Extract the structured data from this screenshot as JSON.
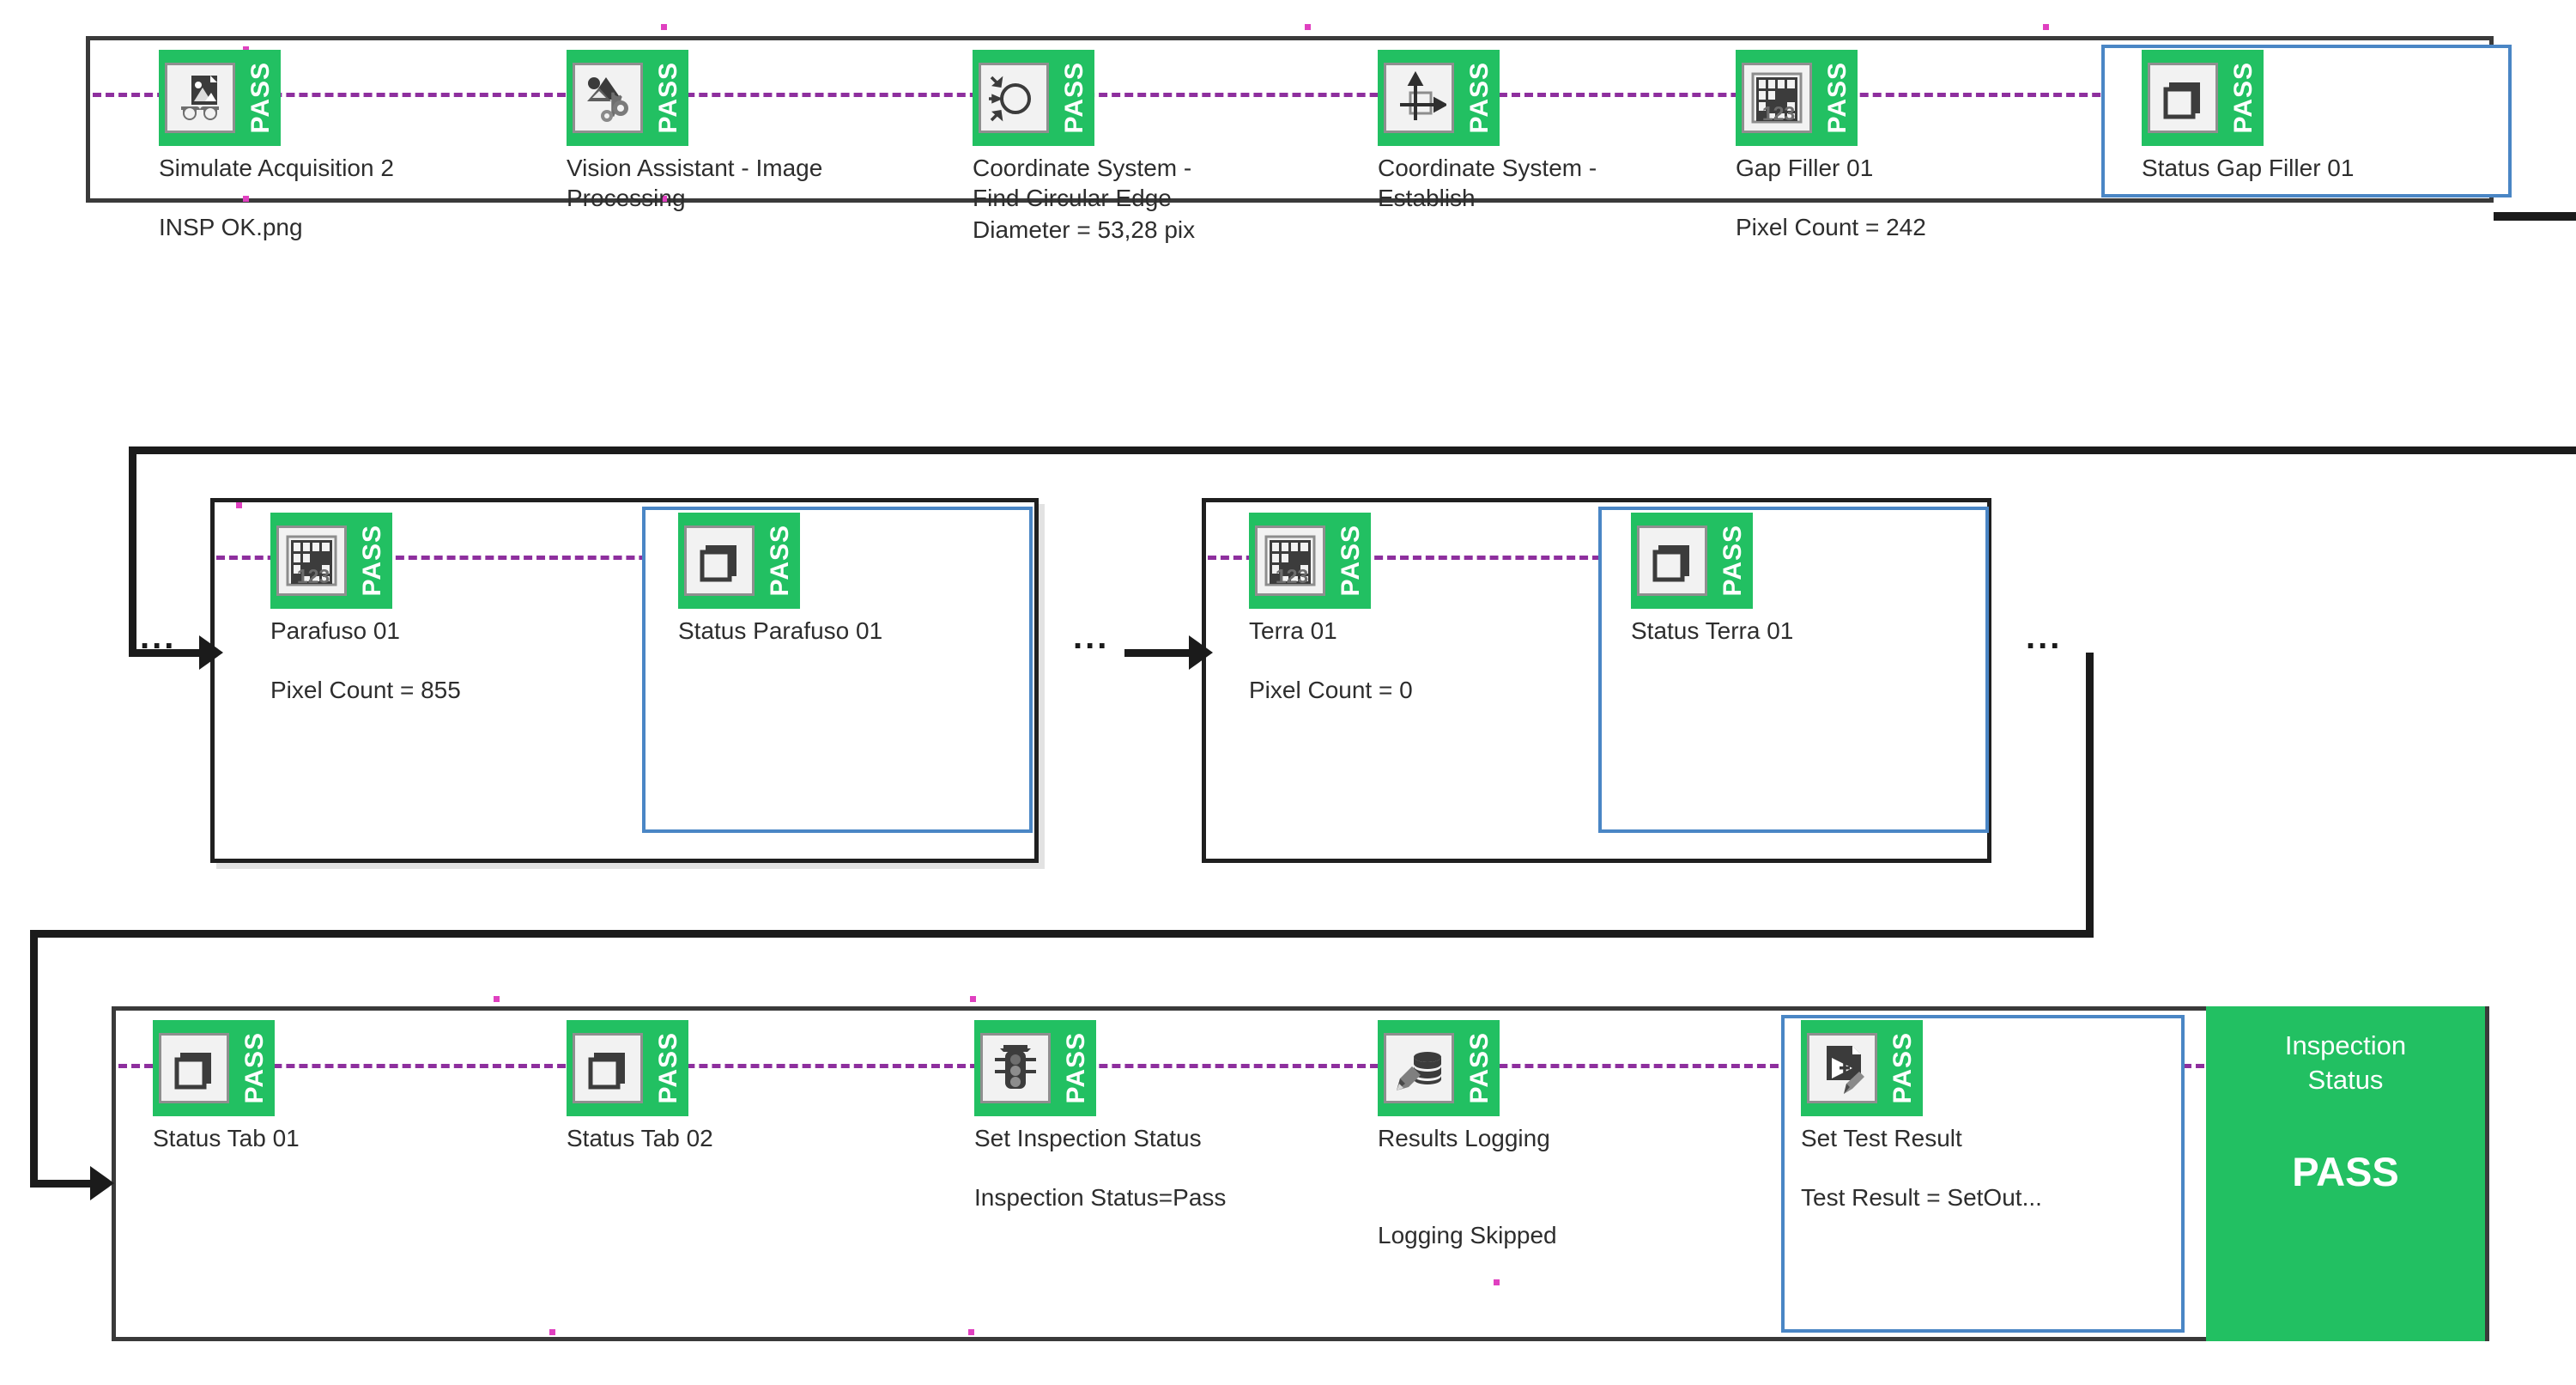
{
  "meta": {
    "app": "Vision Builder AI Inspection Flow",
    "pass_label": "PASS",
    "ellipsis": "...",
    "colors": {
      "pass_green": "#22c062",
      "selection_blue": "#4a86c5",
      "wire_magenta": "#8e2f9e",
      "frame_dark": "#3a3a3a"
    }
  },
  "rows": [
    {
      "id": "row-1",
      "steps": [
        {
          "name": "simulate-acquisition-2",
          "icon": "image-inspect-glasses-icon",
          "label": "Simulate Acquisition 2",
          "detail": "INSP OK.png",
          "status": "PASS",
          "selected": false
        },
        {
          "name": "vision-assistant-image-processing",
          "icon": "image-processing-gears-icon",
          "label": "Vision Assistant - Image\nProcessing",
          "detail": "",
          "status": "PASS",
          "selected": false
        },
        {
          "name": "coordinate-system-find-circular-edge",
          "icon": "find-circular-edge-icon",
          "label": "Coordinate System -\nFind Circular Edge",
          "detail": "Diameter = 53,28 pix",
          "status": "PASS",
          "selected": false
        },
        {
          "name": "coordinate-system-establish",
          "icon": "coordinate-axes-icon",
          "label": "Coordinate System -\nEstablish",
          "detail": "",
          "status": "PASS",
          "selected": false
        },
        {
          "name": "gap-filler-01",
          "icon": "pixel-count-123-icon",
          "label": "Gap Filler 01",
          "detail": "Pixel Count = 242",
          "status": "PASS",
          "selected": false
        },
        {
          "name": "status-gap-filler-01",
          "icon": "status-squares-icon",
          "label": "Status Gap Filler 01",
          "detail": "",
          "status": "PASS",
          "selected": true
        }
      ]
    },
    {
      "id": "row-2",
      "groups": [
        {
          "name": "group-parafuso",
          "steps": [
            {
              "name": "parafuso-01",
              "icon": "pixel-count-123-icon",
              "label": "Parafuso 01",
              "detail": "Pixel Count = 855",
              "status": "PASS",
              "selected": false
            },
            {
              "name": "status-parafuso-01",
              "icon": "status-squares-icon",
              "label": "Status Parafuso 01",
              "detail": "",
              "status": "PASS",
              "selected": true
            }
          ]
        },
        {
          "name": "group-terra",
          "steps": [
            {
              "name": "terra-01",
              "icon": "pixel-count-123-icon",
              "label": "Terra 01",
              "detail": "Pixel Count = 0",
              "status": "PASS",
              "selected": false
            },
            {
              "name": "status-terra-01",
              "icon": "status-squares-icon",
              "label": "Status Terra 01",
              "detail": "",
              "status": "PASS",
              "selected": true
            }
          ]
        }
      ]
    },
    {
      "id": "row-3",
      "steps": [
        {
          "name": "status-tab-01",
          "icon": "status-squares-icon",
          "label": "Status Tab 01",
          "detail": "",
          "status": "PASS",
          "selected": false
        },
        {
          "name": "status-tab-02",
          "icon": "status-squares-icon",
          "label": "Status Tab 02",
          "detail": "",
          "status": "PASS",
          "selected": false
        },
        {
          "name": "set-inspection-status",
          "icon": "traffic-light-icon",
          "label": "Set Inspection Status",
          "detail": "Inspection Status=Pass",
          "status": "PASS",
          "selected": false
        },
        {
          "name": "results-logging",
          "icon": "database-pencil-icon",
          "label": "Results Logging",
          "detail": "Logging Skipped",
          "status": "PASS",
          "selected": false
        },
        {
          "name": "set-test-result",
          "icon": "test-result-document-icon",
          "label": "Set Test Result",
          "detail": "Test Result = SetOut...",
          "status": "PASS",
          "selected": true
        }
      ]
    }
  ],
  "inspection_status": {
    "title": "Inspection\nStatus",
    "value": "PASS"
  }
}
